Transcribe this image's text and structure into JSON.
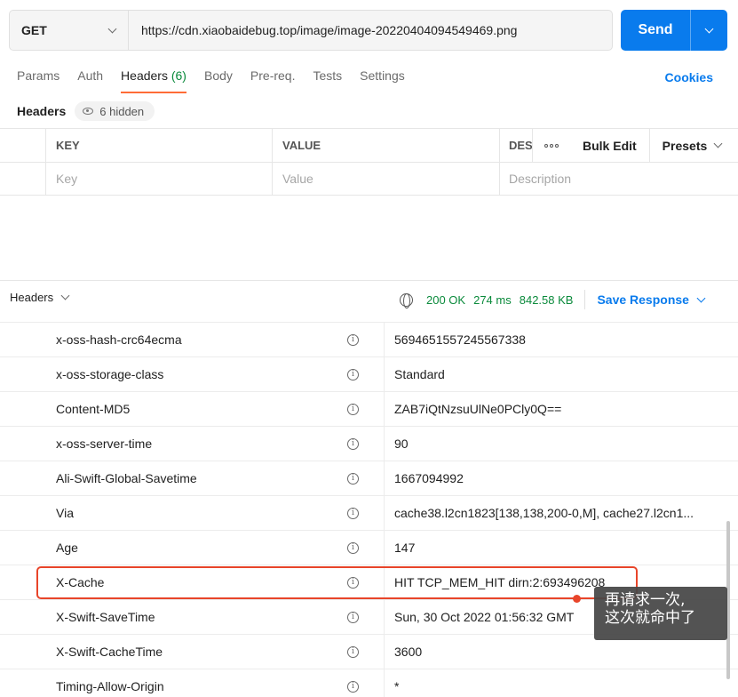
{
  "request": {
    "method": "GET",
    "url": "https://cdn.xiaobaidebug.top/image/image-20220404094549469.png",
    "send_label": "Send"
  },
  "tabs": [
    {
      "label": "Params"
    },
    {
      "label": "Auth"
    },
    {
      "label": "Headers",
      "count": "(6)",
      "active": true
    },
    {
      "label": "Body"
    },
    {
      "label": "Pre-req."
    },
    {
      "label": "Tests"
    },
    {
      "label": "Settings"
    }
  ],
  "cookies_label": "Cookies",
  "request_headers": {
    "title": "Headers",
    "hidden_label": "6 hidden",
    "columns": {
      "key": "KEY",
      "value": "VALUE",
      "description": "DES"
    },
    "placeholders": {
      "key": "Key",
      "value": "Value",
      "description": "Description"
    },
    "bulk_edit": "Bulk Edit",
    "presets": "Presets"
  },
  "response": {
    "section_label": "Headers",
    "status": "200 OK",
    "time": "274 ms",
    "size": "842.58 KB",
    "save_label": "Save Response",
    "headers": [
      {
        "key": "x-oss-hash-crc64ecma",
        "value": "5694651557245567338"
      },
      {
        "key": "x-oss-storage-class",
        "value": "Standard"
      },
      {
        "key": "Content-MD5",
        "value": "ZAB7iQtNzsuUlNe0PCly0Q=="
      },
      {
        "key": "x-oss-server-time",
        "value": "90"
      },
      {
        "key": "Ali-Swift-Global-Savetime",
        "value": "1667094992"
      },
      {
        "key": "Via",
        "value": "cache38.l2cn1823[138,138,200-0,M], cache27.l2cn1..."
      },
      {
        "key": "Age",
        "value": "147"
      },
      {
        "key": "X-Cache",
        "value": "HIT TCP_MEM_HIT dirn:2:693496208"
      },
      {
        "key": "X-Swift-SaveTime",
        "value": "Sun, 30 Oct 2022 01:56:32 GMT"
      },
      {
        "key": "X-Swift-CacheTime",
        "value": "3600"
      },
      {
        "key": "Timing-Allow-Origin",
        "value": "*"
      }
    ]
  },
  "annotation": {
    "line1": "再请求一次,",
    "line2": "这次就命中了",
    "color": "#e8452a"
  },
  "colors": {
    "accent": "#097bed",
    "active_tab": "#ff6c37",
    "status_green": "#0a8a3b"
  }
}
